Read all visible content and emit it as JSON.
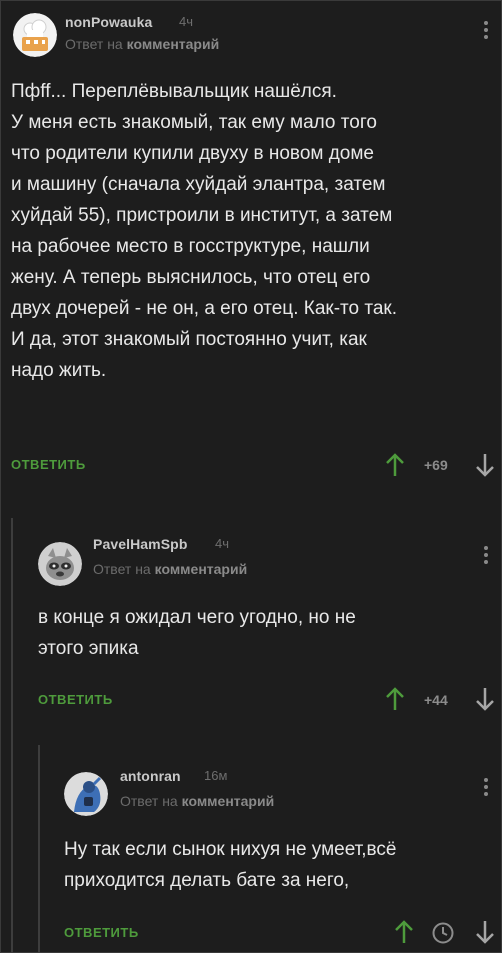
{
  "comments": [
    {
      "username": "nonPowauka",
      "time": "4ч",
      "reply_prefix": "Ответ на ",
      "reply_target": "комментарий",
      "text": "Пфff... Переплёвывальщик нашёлся.\nУ меня есть знакомый, так ему мало того\nчто родители купили двуху в новом доме\nи машину (сначала хуйдай элантра, затем\nхуйдай 55), пристроили в институт, а затем\nна рабочее место в госструктуре, нашли\nжену. А теперь выяснилось, что отец его\nдвух дочерей - не он, а его отец. Как-то так.\nИ да, этот знакомый постоянно учит, как\nнадо жить.",
      "reply_label": "ОТВЕТИТЬ",
      "score": "+69",
      "avatar_icon": "chef-avatar-icon"
    },
    {
      "username": "PavelHamSpb",
      "time": "4ч",
      "reply_prefix": "Ответ на ",
      "reply_target": "комментарий",
      "text": "в конце я ожидал чего угодно, но не\nэтого эпика",
      "reply_label": "ОТВЕТИТЬ",
      "score": "+44",
      "avatar_icon": "raccoon-avatar-icon"
    },
    {
      "username": "antonran",
      "time": "16м",
      "reply_prefix": "Ответ на ",
      "reply_target": "комментарий",
      "text": "Ну так если сынок нихуя не умеет,всё\nприходится делать бате за него,",
      "reply_label": "ОТВЕТИТЬ",
      "score_icon": "clock-icon",
      "avatar_icon": "blue-figure-avatar-icon"
    }
  ],
  "colors": {
    "background": "#1d1d1d",
    "reply_green": "#4e9b3c",
    "thread_line": "#3d3d3d"
  }
}
